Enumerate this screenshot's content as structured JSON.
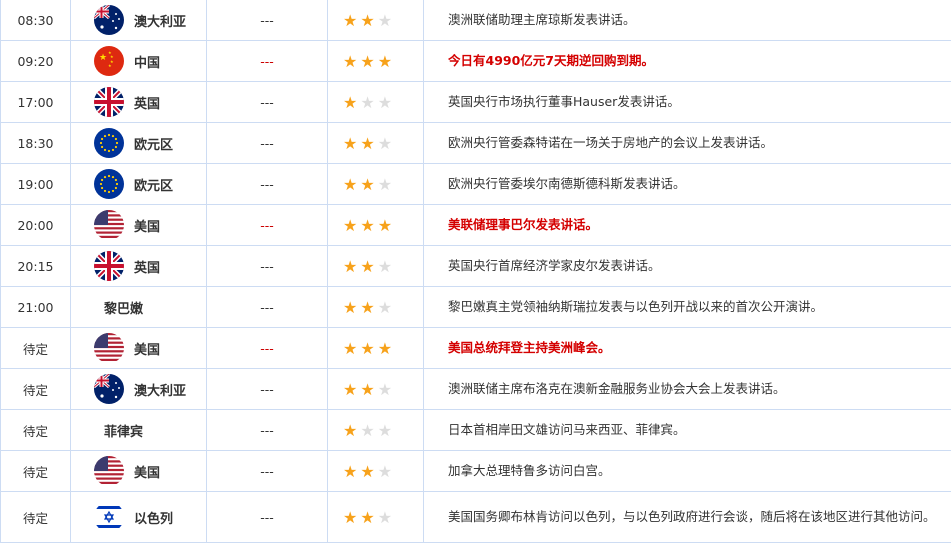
{
  "colors": {
    "highlight": "#d40000",
    "star_on": "#f7a21b",
    "star_off": "#dddddd",
    "border": "#cddcf3"
  },
  "rows": [
    {
      "time": "08:30",
      "country": "澳大利亚",
      "flag": "australia-flag-icon",
      "value": "---",
      "stars": 2,
      "desc": "澳洲联储助理主席琼斯发表讲话。",
      "important": false
    },
    {
      "time": "09:20",
      "country": "中国",
      "flag": "china-flag-icon",
      "value": "---",
      "stars": 3,
      "desc": "今日有4990亿元7天期逆回购到期。",
      "important": true
    },
    {
      "time": "17:00",
      "country": "英国",
      "flag": "uk-flag-icon",
      "value": "---",
      "stars": 1,
      "desc": "英国央行市场执行董事Hauser发表讲话。",
      "important": false
    },
    {
      "time": "18:30",
      "country": "欧元区",
      "flag": "eu-flag-icon",
      "value": "---",
      "stars": 2,
      "desc": "欧洲央行管委森特诺在一场关于房地产的会议上发表讲话。",
      "important": false
    },
    {
      "time": "19:00",
      "country": "欧元区",
      "flag": "eu-flag-icon",
      "value": "---",
      "stars": 2,
      "desc": "欧洲央行管委埃尔南德斯德科斯发表讲话。",
      "important": false
    },
    {
      "time": "20:00",
      "country": "美国",
      "flag": "us-flag-icon",
      "value": "---",
      "stars": 3,
      "desc": "美联储理事巴尔发表讲话。",
      "important": true
    },
    {
      "time": "20:15",
      "country": "英国",
      "flag": "uk-flag-icon",
      "value": "---",
      "stars": 2,
      "desc": "英国央行首席经济学家皮尔发表讲话。",
      "important": false
    },
    {
      "time": "21:00",
      "country": "黎巴嫩",
      "flag": "",
      "value": "---",
      "stars": 2,
      "desc": "黎巴嫩真主党领袖纳斯瑞拉发表与以色列开战以来的首次公开演讲。",
      "important": false
    },
    {
      "time": "待定",
      "country": "美国",
      "flag": "us-flag-icon",
      "value": "---",
      "stars": 3,
      "desc": "美国总统拜登主持美洲峰会。",
      "important": true
    },
    {
      "time": "待定",
      "country": "澳大利亚",
      "flag": "australia-flag-icon",
      "value": "---",
      "stars": 2,
      "desc": "澳洲联储主席布洛克在澳新金融服务业协会大会上发表讲话。",
      "important": false
    },
    {
      "time": "待定",
      "country": "菲律宾",
      "flag": "",
      "value": "---",
      "stars": 1,
      "desc": "日本首相岸田文雄访问马来西亚、菲律宾。",
      "important": false
    },
    {
      "time": "待定",
      "country": "美国",
      "flag": "us-flag-icon",
      "value": "---",
      "stars": 2,
      "desc": "加拿大总理特鲁多访问白宫。",
      "important": false
    },
    {
      "time": "待定",
      "country": "以色列",
      "flag": "israel-flag-icon",
      "value": "---",
      "stars": 2,
      "desc": "美国国务卿布林肯访问以色列，与以色列政府进行会谈，随后将在该地区进行其他访问。",
      "important": false
    }
  ]
}
